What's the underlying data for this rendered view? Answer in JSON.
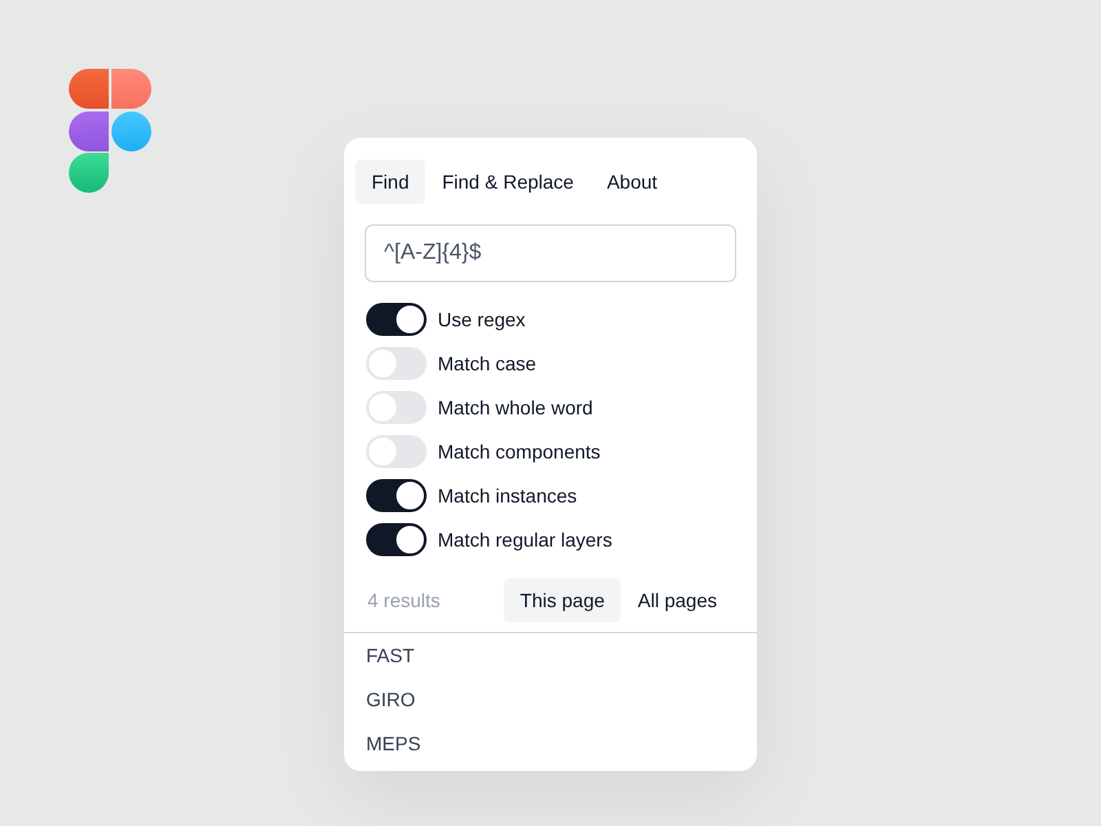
{
  "tabs": [
    {
      "label": "Find",
      "selected": true
    },
    {
      "label": "Find & Replace",
      "selected": false
    },
    {
      "label": "About",
      "selected": false
    }
  ],
  "search": {
    "value": "^[A-Z]{4}$"
  },
  "options": [
    {
      "label": "Use regex",
      "on": true
    },
    {
      "label": "Match case",
      "on": false
    },
    {
      "label": "Match whole word",
      "on": false
    },
    {
      "label": "Match components",
      "on": false
    },
    {
      "label": "Match instances",
      "on": true
    },
    {
      "label": "Match regular layers",
      "on": true
    }
  ],
  "results": {
    "count": "4 results",
    "scope_tabs": [
      {
        "label": "This page",
        "selected": true
      },
      {
        "label": "All pages",
        "selected": false
      }
    ],
    "items": [
      "FAST",
      "GIRO",
      "MEPS"
    ]
  }
}
